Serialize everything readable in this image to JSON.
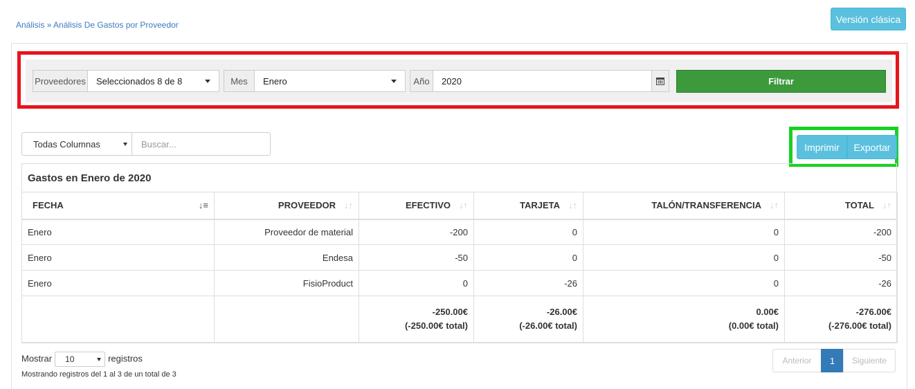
{
  "breadcrumb": {
    "root": "Análisis",
    "separator": " » ",
    "current": "Análisis De Gastos por Proveedor"
  },
  "header": {
    "classic_button": "Versión clásica"
  },
  "filters": {
    "providers_label": "Proveedores",
    "providers_value": "Seleccionados 8 de 8",
    "month_label": "Mes",
    "month_value": "Enero",
    "year_label": "Año",
    "year_value": "2020",
    "calendar_icon": "calendar-icon",
    "filter_button": "Filtrar"
  },
  "search": {
    "columns_value": "Todas Columnas",
    "placeholder": "Buscar..."
  },
  "actions": {
    "print": "Imprimir",
    "export": "Exportar"
  },
  "table": {
    "title": "Gastos en Enero de 2020",
    "headers": [
      "FECHA",
      "PROVEEDOR",
      "EFECTIVO",
      "TARJETA",
      "TALÓN/TRANSFERENCIA",
      "TOTAL"
    ],
    "rows": [
      [
        "Enero",
        "Proveedor de material",
        "-200",
        "0",
        "0",
        "-200"
      ],
      [
        "Enero",
        "Endesa",
        "-50",
        "0",
        "0",
        "-50"
      ],
      [
        "Enero",
        "FisioProduct",
        "0",
        "-26",
        "0",
        "-26"
      ]
    ],
    "totals": {
      "efectivo": "-250.00€",
      "efectivo_total": "(-250.00€ total)",
      "tarjeta": "-26.00€",
      "tarjeta_total": "(-26.00€ total)",
      "talon": "0.00€",
      "talon_total": "(0.00€ total)",
      "total": "-276.00€",
      "total_total": "(-276.00€ total)"
    }
  },
  "footer": {
    "show_label": "Mostrar",
    "page_size": "10",
    "records_label": "registros",
    "info": "Mostrando registros del 1 al 3 de un total de 3"
  },
  "pagination": {
    "prev": "Anterior",
    "current": "1",
    "next": "Siguiente"
  },
  "colors": {
    "info_button": "#5bc0de",
    "filter_button": "#3c9a3c",
    "highlight_red": "#e8141c",
    "highlight_green": "#19d124",
    "pager_active": "#337ab7"
  }
}
